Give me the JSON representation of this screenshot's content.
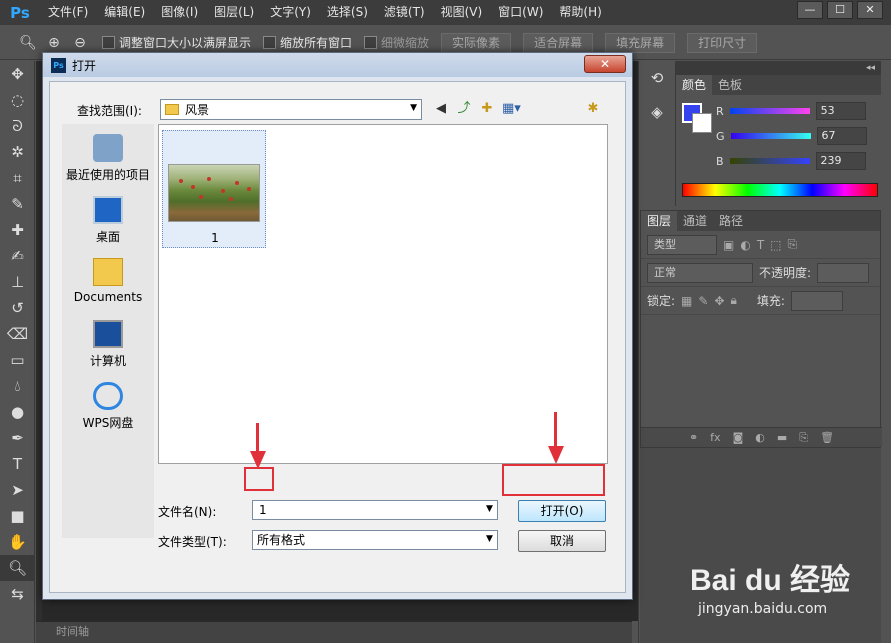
{
  "app": {
    "logo": "Ps",
    "menu": [
      "文件(F)",
      "编辑(E)",
      "图像(I)",
      "图层(L)",
      "文字(Y)",
      "选择(S)",
      "滤镜(T)",
      "视图(V)",
      "窗口(W)",
      "帮助(H)"
    ],
    "window_controls": [
      "—",
      "☐",
      "✕"
    ]
  },
  "options_bar": {
    "resize_windows": "调整窗口大小以满屏显示",
    "zoom_all": "缩放所有窗口",
    "scrubby_zoom": "细微缩放",
    "actual_pixels": "实际像素",
    "fit_screen": "适合屏幕",
    "fill_screen": "填充屏幕",
    "print_size": "打印尺寸"
  },
  "timeline_label": "时间轴",
  "color_panel": {
    "tabs": [
      "颜色",
      "色板"
    ],
    "r_label": "R",
    "r_value": "53",
    "g_label": "G",
    "g_value": "67",
    "b_label": "B",
    "b_value": "239",
    "fg_color": "#3543ef"
  },
  "layers_panel": {
    "tabs": [
      "图层",
      "通道",
      "路径"
    ],
    "filter_kind": "类型",
    "blend_mode": "正常",
    "opacity_label": "不透明度:",
    "lock_label": "锁定:",
    "fill_label": "填充:"
  },
  "dialog": {
    "title": "打开",
    "close": "✕",
    "look_in_label": "查找范围(I):",
    "look_in_value": "风景",
    "places": [
      "最近使用的项目",
      "桌面",
      "Documents",
      "计算机",
      "WPS网盘"
    ],
    "file_item_label": "1",
    "filename_label": "文件名(N):",
    "filename_value": "1",
    "filetype_label": "文件类型(T):",
    "filetype_value": "所有格式",
    "open_button": "打开(O)",
    "cancel_button": "取消"
  },
  "watermark": {
    "logo": "Bai du 经验",
    "url": "jingyan.baidu.com"
  },
  "annotation_color": "#e0313a"
}
